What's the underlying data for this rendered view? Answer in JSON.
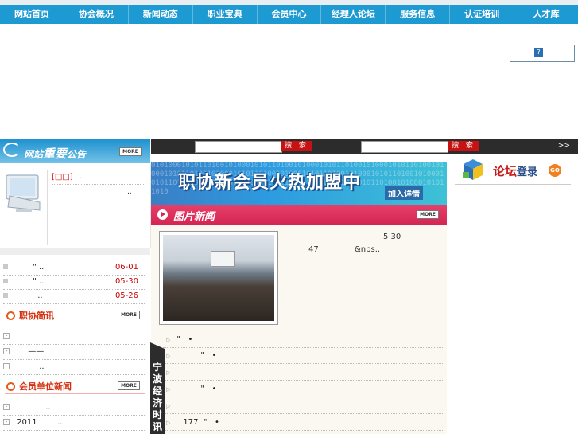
{
  "nav": {
    "items": [
      "网站首页",
      "协会概况",
      "新闻动态",
      "职业宝典",
      "会员中心",
      "经理人论坛",
      "服务信息",
      "认证培训",
      "人才库"
    ]
  },
  "top_box": {
    "icon_text": "?"
  },
  "notice": {
    "title_prefix": "网站",
    "title_bold": "重要",
    "title_suffix": "公告",
    "more": "MORE",
    "link_text": "[□□]",
    "line1_tail": "..",
    "line2_tail": ".."
  },
  "notice_list": [
    {
      "text": "\" ..",
      "date": "06-01"
    },
    {
      "text": "\" ..",
      "date": "05-30"
    },
    {
      "text": "..",
      "date": "05-26"
    }
  ],
  "brief": {
    "title": "职协简讯",
    "more": "MORE",
    "rows": [
      "",
      "——",
      ".."
    ]
  },
  "member_news": {
    "title": "会员单位新闻",
    "more": "MORE",
    "rows": [
      "..",
      "2011        .."
    ]
  },
  "search": {
    "button1": "搜 索",
    "button2": "搜 索",
    "arrows": ">>"
  },
  "banner": {
    "headline": "职协新会员火热加盟中",
    "join": "加入详情",
    "binary": "0101000101011010010100010101101001010001010110100101000101011010010100010101101001010001010110100101000101011010010100010101101001010001010110100101000101011010010100010101101001010001010110100101000101011010"
  },
  "pic_news": {
    "title": "图片新闻",
    "more": "MORE",
    "text_line1": "5 30",
    "text_line2a": "47",
    "text_line2b": "&nbs.."
  },
  "center_list": [
    "\"   •",
    "\"   •",
    "",
    "\"   •",
    "",
    "177  \"   •"
  ],
  "side_tab": {
    "text": "宁波经济时讯"
  },
  "forum": {
    "title": "论坛",
    "title_small": "登录",
    "go": "GO"
  },
  "colors": {
    "nav_bg": "#1e9ad3",
    "pic_news_bg": "#d42553",
    "search_btn": "#c61212",
    "date_red": "#cc0000"
  }
}
